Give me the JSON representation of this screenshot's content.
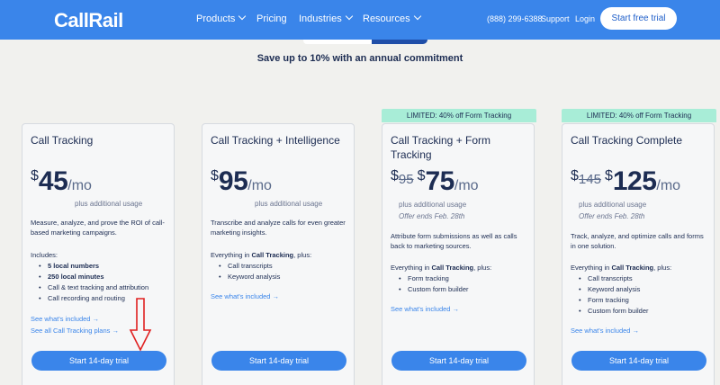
{
  "header": {
    "logo": "CallRail",
    "nav": [
      {
        "label": "Products",
        "dropdown": true
      },
      {
        "label": "Pricing",
        "dropdown": false
      },
      {
        "label": "Industries",
        "dropdown": true
      },
      {
        "label": "Resources",
        "dropdown": true
      }
    ],
    "phone": "(888) 299-6388",
    "support": "Support",
    "login": "Login",
    "cta": "Start free trial"
  },
  "subtitle": "Save up to 10% with an annual commitment",
  "plans": [
    {
      "title": "Call Tracking",
      "currency": "$",
      "price": "45",
      "period": "/mo",
      "note": "plus additional usage",
      "description": "Measure, analyze, and prove the ROI of call-based marketing campaigns.",
      "includes_label": "Includes:",
      "features": [
        "5 local numbers",
        "250 local minutes",
        "Call & text tracking and attribution",
        "Call recording and routing"
      ],
      "links": [
        "See what's included →",
        "See all Call Tracking plans →"
      ],
      "cta": "Start 14-day trial"
    },
    {
      "title": "Call Tracking + Intelligence",
      "currency": "$",
      "price": "95",
      "period": "/mo",
      "note": "plus additional usage",
      "description": "Transcribe and analyze calls for even greater marketing insights.",
      "includes_prefix": "Everything in ",
      "includes_bold": "Call Tracking",
      "includes_suffix": ", plus:",
      "features": [
        "Call transcripts",
        "Keyword analysis"
      ],
      "links": [
        "See what's included →"
      ],
      "cta": "Start 14-day trial"
    },
    {
      "ribbon": "LIMITED: 40% off Form Tracking",
      "title": "Call Tracking + Form Tracking",
      "currency": "$",
      "old_price": "95",
      "price": "75",
      "period": "/mo",
      "note": "plus additional usage",
      "offer": "Offer ends Feb. 28th",
      "description": "Attribute form submissions as well as calls back to marketing sources.",
      "includes_prefix": "Everything in ",
      "includes_bold": "Call Tracking",
      "includes_suffix": ", plus:",
      "features": [
        "Form tracking",
        "Custom form builder"
      ],
      "links": [
        "See what's included →"
      ],
      "cta": "Start 14-day trial"
    },
    {
      "ribbon": "LIMITED: 40% off Form Tracking",
      "title": "Call Tracking Complete",
      "currency": "$",
      "old_price": "145",
      "price": "125",
      "period": "/mo",
      "note": "plus additional usage",
      "offer": "Offer ends Feb. 28th",
      "description": "Track, analyze, and optimize calls and forms in one solution.",
      "includes_prefix": "Everything in ",
      "includes_bold": "Call Tracking",
      "includes_suffix": ", plus:",
      "features": [
        "Call transcripts",
        "Keyword analysis",
        "Form tracking",
        "Custom form builder"
      ],
      "links": [
        "See what's included →"
      ],
      "cta": "Start 14-day trial"
    }
  ],
  "colors": {
    "brand_blue": "#3a85ea",
    "navy_text": "#1c2c52",
    "promo_green": "#a8edd7",
    "annotation_red": "#e02020",
    "page_bg": "#f1f1ee"
  }
}
